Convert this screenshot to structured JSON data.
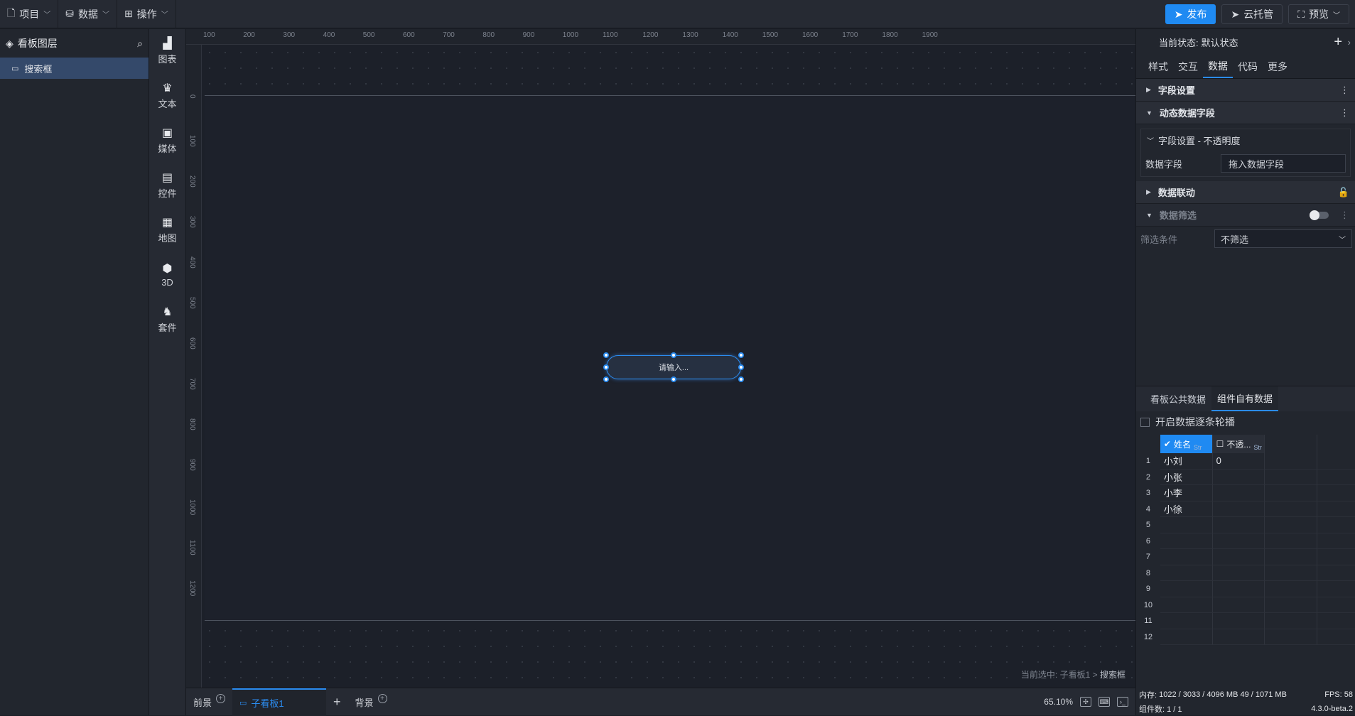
{
  "topbar": {
    "menus": [
      {
        "icon": "file-icon",
        "label": "项目"
      },
      {
        "icon": "database-icon",
        "label": "数据"
      },
      {
        "icon": "grid-icon",
        "label": "操作"
      }
    ],
    "publish": "发布",
    "cloud": "云托管",
    "preview": "预览"
  },
  "layers": {
    "title": "看板图层",
    "items": [
      "搜索框"
    ]
  },
  "iconbar": [
    {
      "icon": "chart-icon",
      "label": "图表"
    },
    {
      "icon": "text-icon",
      "label": "文本"
    },
    {
      "icon": "media-icon",
      "label": "媒体"
    },
    {
      "icon": "control-icon",
      "label": "控件"
    },
    {
      "icon": "map-icon",
      "label": "地图"
    },
    {
      "icon": "cube-icon",
      "label": "3D"
    },
    {
      "icon": "kit-icon",
      "label": "套件"
    }
  ],
  "ruler": {
    "h": [
      "100",
      "200",
      "300",
      "400",
      "500",
      "600",
      "700",
      "800",
      "900",
      "1000",
      "1100",
      "1200",
      "1300",
      "1400",
      "1500",
      "1600",
      "1700",
      "1800",
      "1900"
    ],
    "v": [
      "0",
      "100",
      "200",
      "300",
      "400",
      "500",
      "600",
      "700",
      "800",
      "900",
      "1000",
      "1100",
      "1200"
    ]
  },
  "canvas": {
    "search_placeholder": "请输入...",
    "crumb_prefix": "当前选中:",
    "crumb_board": "子看板1",
    "crumb_sep": ">",
    "crumb_item": "搜索框"
  },
  "bottombar": {
    "front": "前景",
    "board": "子看板1",
    "back": "背景",
    "zoom": "65.10%"
  },
  "rightpanel": {
    "state_label": "当前状态:",
    "state_value": "默认状态",
    "tabs": [
      "样式",
      "交互",
      "数据",
      "代码",
      "更多"
    ],
    "active_tab": "数据",
    "sections": {
      "field_settings": "字段设置",
      "dynamic_fields": "动态数据字段",
      "sub_title": "字段设置 - 不透明度",
      "data_field_label": "数据字段",
      "data_field_value": "拖入数据字段",
      "data_link": "数据联动",
      "data_filter": "数据筛选",
      "filter_label": "筛选条件",
      "filter_value": "不筛选"
    },
    "data_tabs": [
      "看板公共数据",
      "组件自有数据"
    ],
    "carousel_label": "开启数据逐条轮播",
    "grid": {
      "headers": [
        {
          "name": "姓名",
          "type": "Str"
        },
        {
          "name": "不透...",
          "type": "Str"
        }
      ],
      "rows": [
        [
          "1",
          "小刘",
          "0"
        ],
        [
          "2",
          "小张",
          ""
        ],
        [
          "3",
          "小李",
          ""
        ],
        [
          "4",
          "小徐",
          ""
        ],
        [
          "5",
          "",
          ""
        ],
        [
          "6",
          "",
          ""
        ],
        [
          "7",
          "",
          ""
        ],
        [
          "8",
          "",
          ""
        ],
        [
          "9",
          "",
          ""
        ],
        [
          "10",
          "",
          ""
        ],
        [
          "11",
          "",
          ""
        ],
        [
          "12",
          "",
          ""
        ]
      ]
    },
    "status": {
      "memory_label": "内存:",
      "memory_value": "1022 / 3033 / 4096 MB",
      "memory_extra": "49 / 1071 MB",
      "fps": "FPS: 58",
      "components": "组件数: 1 / 1",
      "version": "4.3.0-beta.2"
    }
  }
}
